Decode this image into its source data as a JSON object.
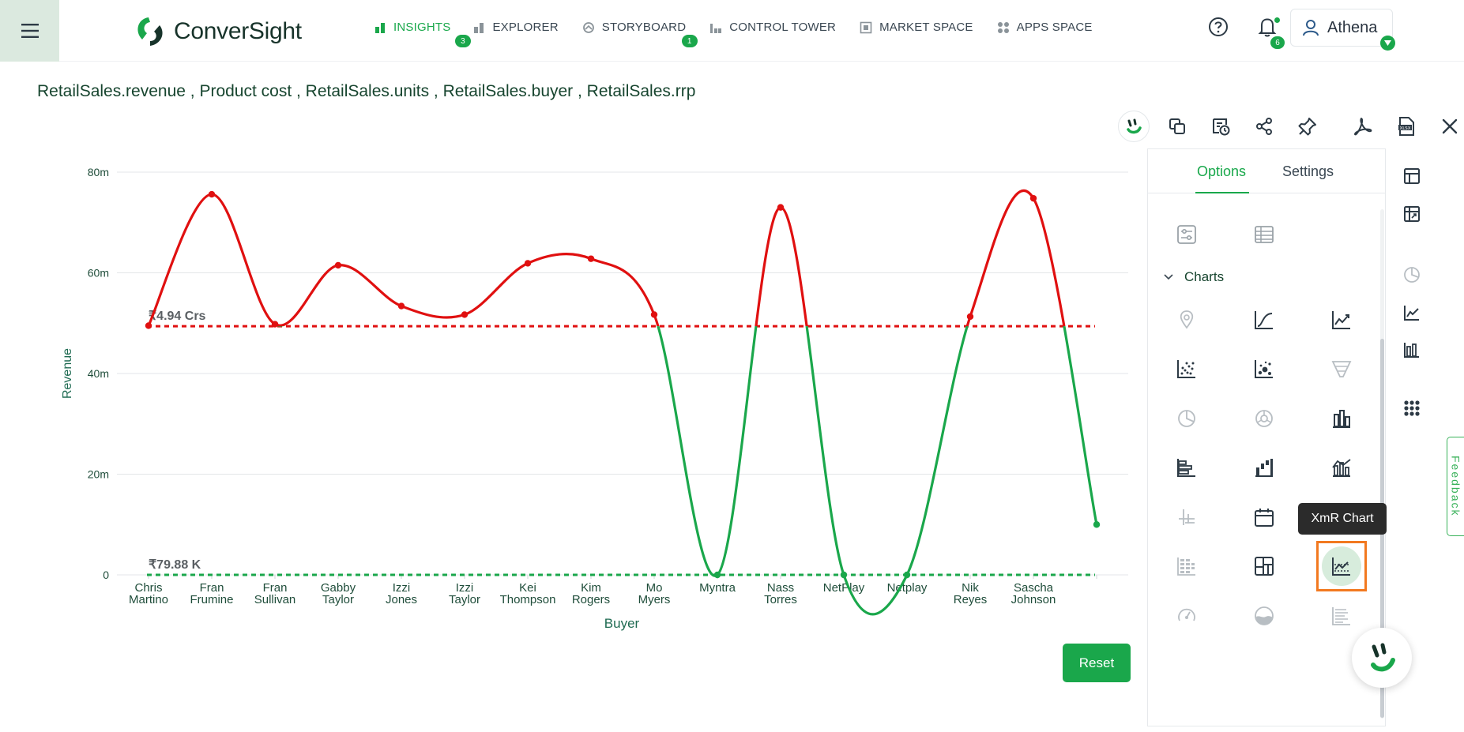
{
  "app": {
    "logo_text": "ConverSight",
    "nav": [
      {
        "label": "INSIGHTS",
        "icon": "bar-chart-icon",
        "badge": "3",
        "active": true
      },
      {
        "label": "EXPLORER",
        "icon": "explorer-icon",
        "badge": "",
        "active": false
      },
      {
        "label": "STORYBOARD",
        "icon": "storyboard-icon",
        "badge": "1",
        "active": false
      },
      {
        "label": "CONTROL TOWER",
        "icon": "control-tower-icon",
        "badge": "",
        "active": false
      },
      {
        "label": "MARKET SPACE",
        "icon": "market-space-icon",
        "badge": "",
        "active": false
      },
      {
        "label": "APPS SPACE",
        "icon": "apps-space-icon",
        "badge": "",
        "active": false
      }
    ],
    "notifications_badge": "6",
    "user_name": "Athena",
    "brand_color": "#1aa74b"
  },
  "query": {
    "title": "RetailSales.revenue , Product cost , RetailSales.units , RetailSales.buyer , RetailSales.rrp"
  },
  "panel": {
    "tabs": [
      "Options",
      "Settings"
    ],
    "active_tab": "Options",
    "section_title": "Charts",
    "tooltip": "XmR Chart",
    "selected_chart": "xmr-chart-icon"
  },
  "reset_label": "Reset",
  "feedback_label": "Feedback",
  "chart_data": {
    "type": "line",
    "xlabel": "Buyer",
    "ylabel": "Revenue",
    "yticks": [
      "80m",
      "60m",
      "40m",
      "20m",
      "0"
    ],
    "ylim": [
      0,
      80
    ],
    "categories": [
      "Chris Martino",
      "Fran Frumine",
      "Fran Sullivan",
      "Gabby Taylor",
      "Izzi Jones",
      "Izzi Taylor",
      "Kei Thompson",
      "Kim Rogers",
      "Mo Myers",
      "Myntra",
      "Nass Torres",
      "NetPlay",
      "Netplay",
      "Nik Reyes",
      "Sascha Johnson",
      ""
    ],
    "values": [
      49.5,
      75.6,
      49.8,
      61.5,
      53.4,
      51.7,
      61.9,
      62.8,
      51.7,
      0,
      73.0,
      0,
      0,
      51.3,
      74.8,
      10
    ],
    "upper_line": {
      "value": 49.4,
      "label": "₹4.94 Crs",
      "color": "#e01010"
    },
    "lower_line": {
      "value": 0,
      "label": "₹79.88 K",
      "color": "#1aa74b"
    },
    "above_color": "#e01010",
    "below_color": "#1aa74b"
  }
}
